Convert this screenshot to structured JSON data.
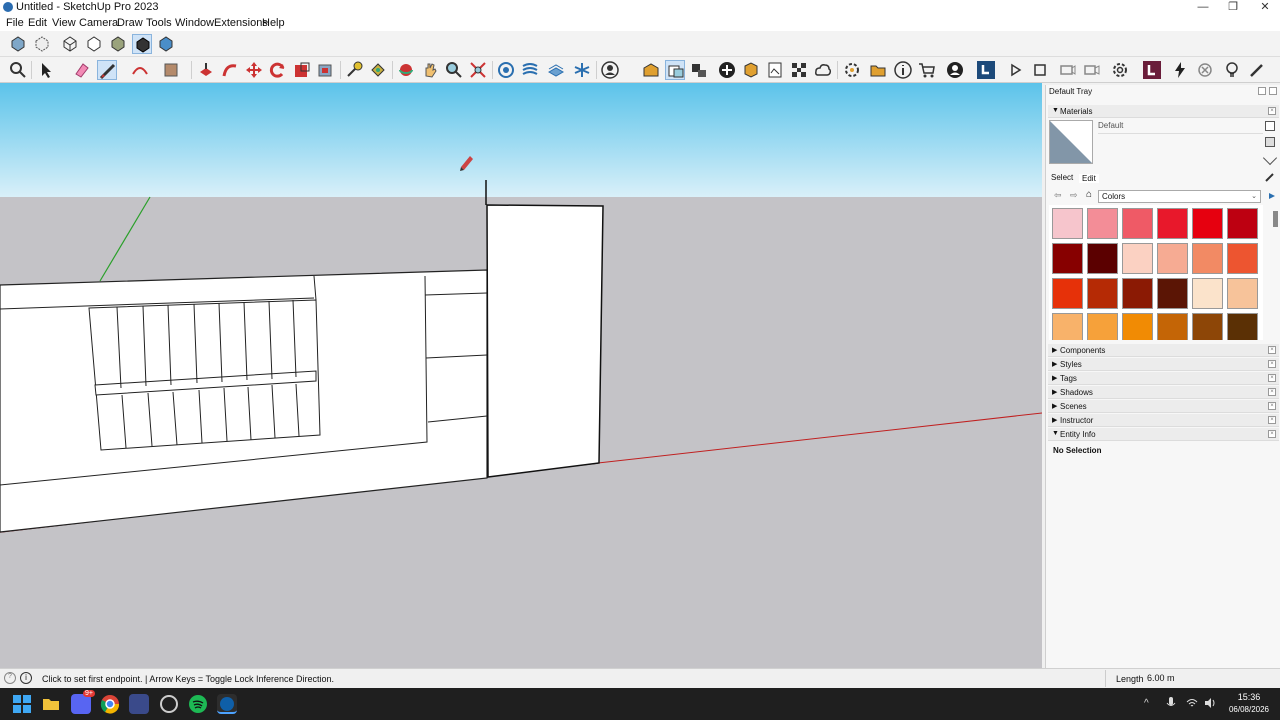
{
  "window": {
    "title": "Untitled - SketchUp Pro 2023",
    "minimize": "—",
    "maximize": "❐",
    "close": "✕"
  },
  "menu": [
    "File",
    "Edit",
    "View",
    "Camera",
    "Draw",
    "Tools",
    "Window",
    "Extensions",
    "Help"
  ],
  "tray": {
    "title": "Default Tray",
    "materials": {
      "header": "Materials",
      "current_name": "Default",
      "tabs": [
        "Select",
        "Edit"
      ],
      "library": "Colors",
      "swatches": [
        "#f6c5cc",
        "#f38d97",
        "#ef5a66",
        "#e8182b",
        "#e6000f",
        "#bd0011",
        "#870000",
        "#5b0000",
        "#fbd1c2",
        "#f6ab93",
        "#f28a64",
        "#ed5530",
        "#e63109",
        "#b52a05",
        "#8b1a04",
        "#5b1505",
        "#fbe3cb",
        "#f7c39a",
        "#f8b26a",
        "#f6a13a",
        "#f18b04",
        "#c46506",
        "#8d4607",
        "#5b3005"
      ]
    },
    "sections": [
      "Components",
      "Styles",
      "Tags",
      "Shadows",
      "Scenes",
      "Instructor",
      "Entity Info"
    ],
    "entity_info": {
      "text": "No Selection"
    }
  },
  "status": {
    "message": "Click to set first endpoint. | Arrow Keys = Toggle Lock Inference Direction.",
    "length_label": "Length",
    "length_value": "6.00 m"
  },
  "taskbar": {
    "time": "15:36",
    "date": "06/08/2026",
    "badge": "9+"
  },
  "colors": {
    "sky_top": "#5bc3ea",
    "sky_bottom": "#d9f0f9",
    "ground": "#c4c3c7",
    "red_axis": "#c02020",
    "green_axis": "#2aa02a"
  }
}
